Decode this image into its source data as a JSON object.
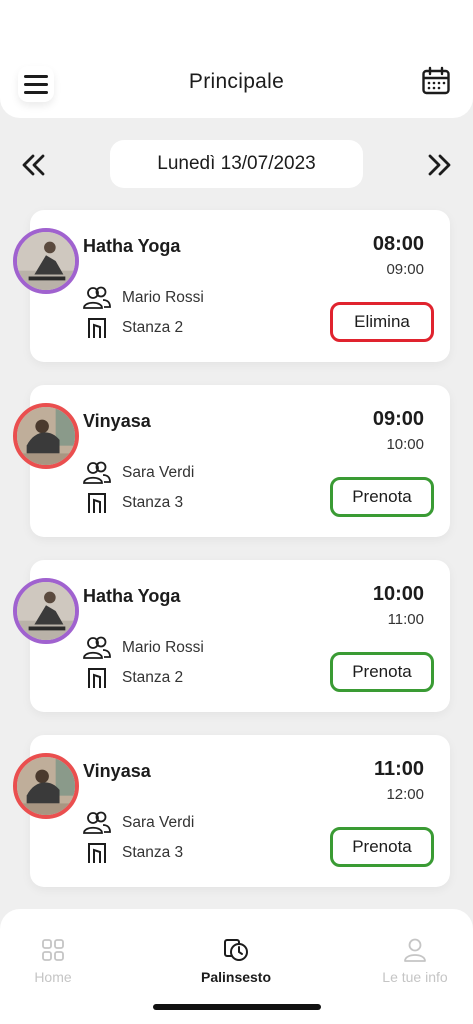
{
  "header": {
    "title": "Principale",
    "menu_icon": "hamburger-menu-icon",
    "calendar_icon": "calendar-icon"
  },
  "date_nav": {
    "date": "Lunedì 13/07/2023",
    "prev_icon": "double-chevron-left-icon",
    "next_icon": "double-chevron-right-icon"
  },
  "classes": [
    {
      "name": "Hatha Yoga",
      "start": "08:00",
      "end": "09:00",
      "instructor": "Mario Rossi",
      "room": "Stanza 2",
      "action": "Elimina",
      "action_color": "#e0232e",
      "avatar_ring": "#a062cf"
    },
    {
      "name": "Vinyasa",
      "start": "09:00",
      "end": "10:00",
      "instructor": "Sara Verdi",
      "room": "Stanza 3",
      "action": "Prenota",
      "action_color": "#3a9b34",
      "avatar_ring": "#ea4f4f"
    },
    {
      "name": "Hatha Yoga",
      "start": "10:00",
      "end": "11:00",
      "instructor": "Mario Rossi",
      "room": "Stanza 2",
      "action": "Prenota",
      "action_color": "#3a9b34",
      "avatar_ring": "#a062cf"
    },
    {
      "name": "Vinyasa",
      "start": "11:00",
      "end": "12:00",
      "instructor": "Sara Verdi",
      "room": "Stanza 3",
      "action": "Prenota",
      "action_color": "#3a9b34",
      "avatar_ring": "#ea4f4f"
    }
  ],
  "bottom_nav": {
    "items": [
      {
        "label": "Home",
        "icon": "grid-icon",
        "active": false
      },
      {
        "label": "Palinsesto",
        "icon": "schedule-clock-icon",
        "active": true
      },
      {
        "label": "Le tue info",
        "icon": "user-icon",
        "active": false
      }
    ]
  }
}
